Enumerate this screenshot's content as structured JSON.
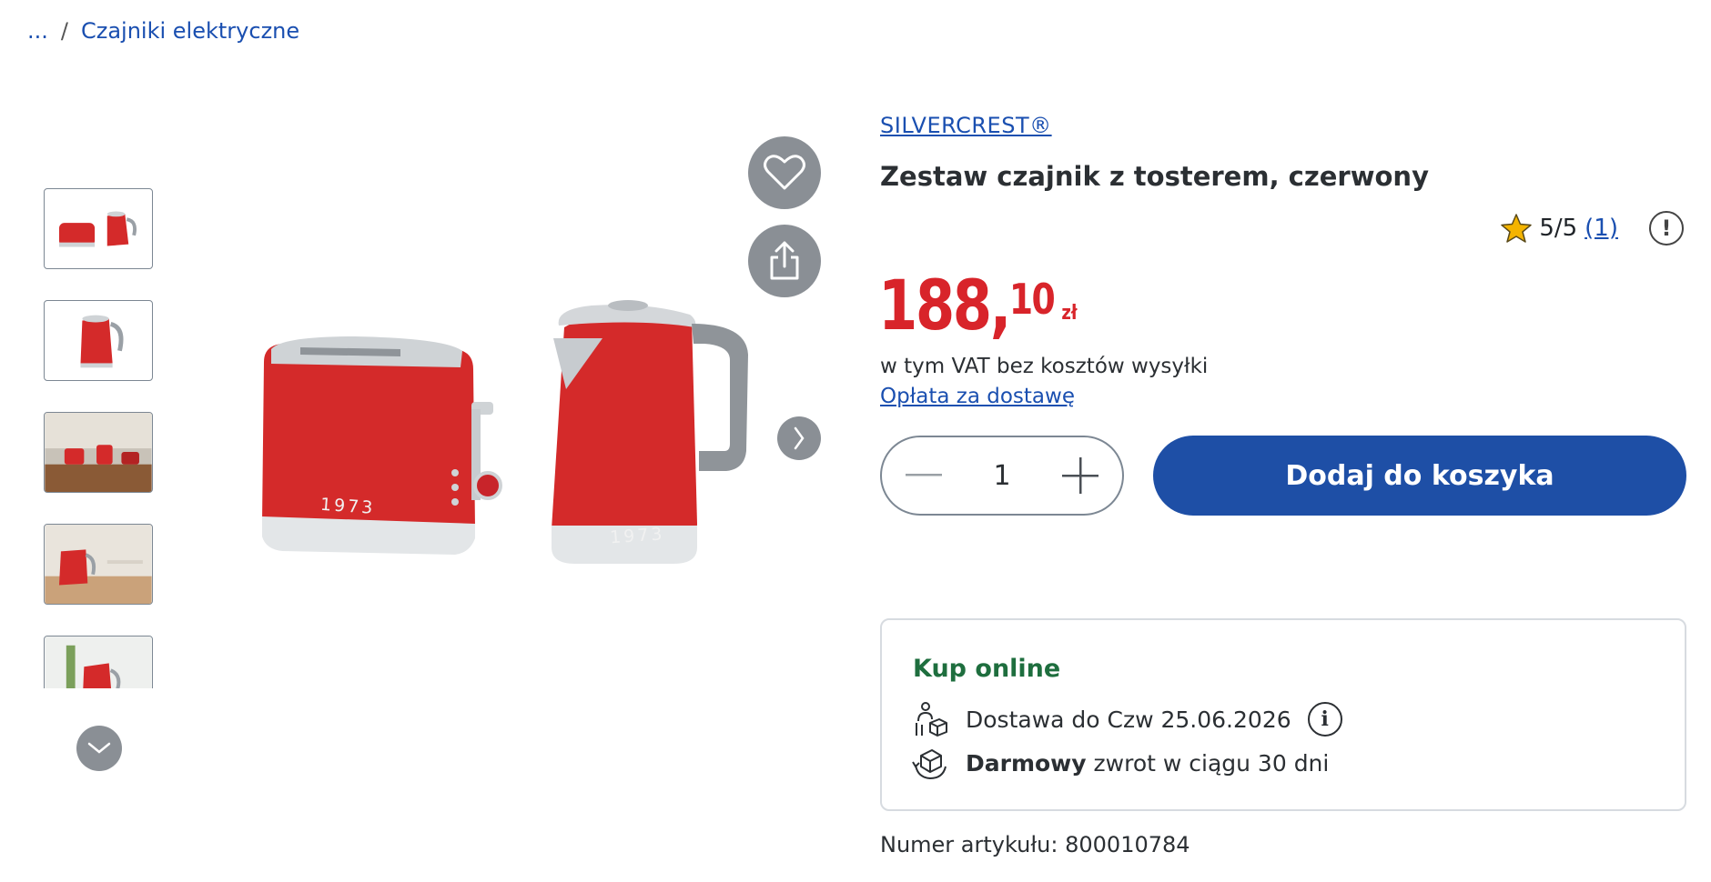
{
  "breadcrumb": {
    "ellipsis": "...",
    "separator": "/",
    "current": "Czajniki elektryczne"
  },
  "product": {
    "brand": "SILVERCREST®",
    "title": "Zestaw czajnik z tosterem, czerwony",
    "rating": {
      "score": "5/5",
      "count": "(1)",
      "stars_filled": 1
    },
    "price": {
      "main": "188,",
      "decimals": "10",
      "currency": "zł"
    },
    "vat_note": "w tym VAT bez kosztów wysyłki",
    "delivery_fee_link": "Opłata za dostawę",
    "quantity": "1",
    "add_to_cart": "Dodaj do koszyka",
    "article_number": "Numer artykułu: 800010784",
    "image_labels": {
      "toaster": "1973",
      "kettle": "1973"
    }
  },
  "online": {
    "title": "Kup online",
    "delivery_text": "Dostawa do Czw 25.06.2026",
    "return_bold": "Darmowy",
    "return_rest": " zwrot w ciągu 30 dni"
  },
  "colors": {
    "accent": "#1e4fa6",
    "price": "#d8242a",
    "online_title": "#1e6e3e",
    "product_red": "#d42a2a"
  },
  "icons": [
    "heart-icon",
    "share-icon",
    "chevron-right-icon",
    "chevron-down-icon",
    "star-icon",
    "alert-icon",
    "minus-icon",
    "plus-icon",
    "delivery-icon",
    "return-icon",
    "info-icon"
  ]
}
